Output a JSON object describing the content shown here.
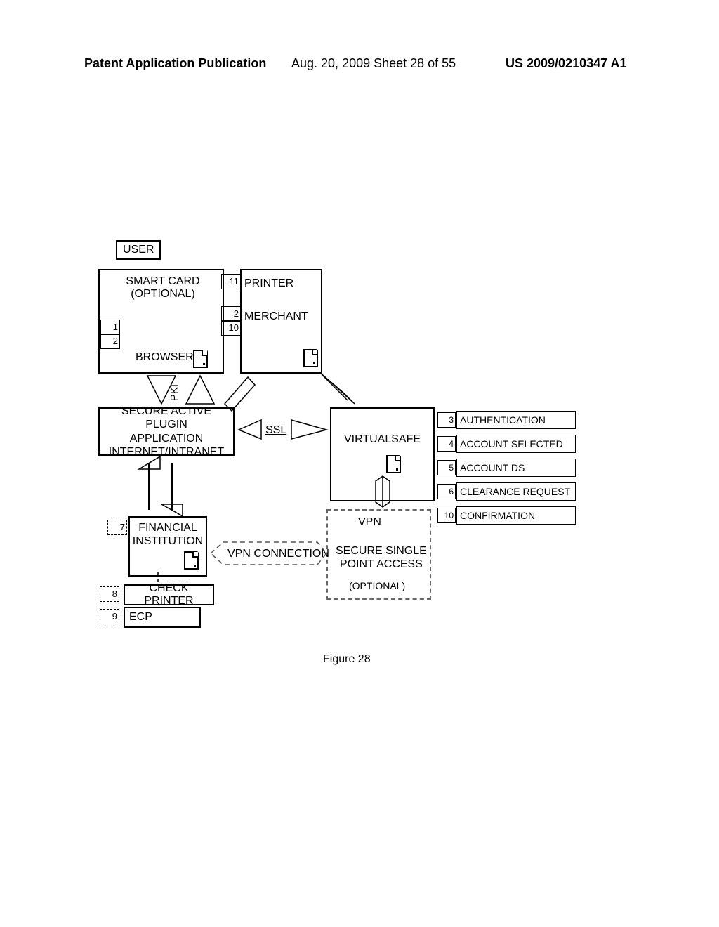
{
  "header": {
    "left": "Patent Application Publication",
    "center": "Aug. 20, 2009  Sheet 28 of 55",
    "right": "US 2009/0210347 A1"
  },
  "caption": "Figure 28",
  "labels": {
    "user": "USER",
    "smart_card_l1": "SMART CARD",
    "smart_card_l2": "(OPTIONAL)",
    "printer": "PRINTER",
    "merchant": "MERCHANT",
    "browser": "BROWSER",
    "pki": "PKI",
    "plugin_l1": "SECURE ACTIVE PLUGIN",
    "plugin_l2": "APPLICATION",
    "plugin_l3": "INTERNET/INTRANET",
    "ssl": "SSL",
    "virtualsafe": "VIRTUALSAFE",
    "vpn": "VPN",
    "vpn_connection": "VPN CONNECTION",
    "secure_l1": "SECURE SINGLE",
    "secure_l2": "POINT ACCESS",
    "optional": "(OPTIONAL)",
    "financial_l1": "FINANCIAL",
    "financial_l2": "INSTITUTION",
    "check_printer": "CHECK PRINTER",
    "ecp": "ECP"
  },
  "numbers": {
    "n1": "1",
    "n2": "2",
    "n2b": "2",
    "n10a": "10",
    "n11": "11",
    "n7": "7",
    "n8": "8",
    "n9": "9"
  },
  "right_list": [
    {
      "num": "3",
      "label": "AUTHENTICATION"
    },
    {
      "num": "4",
      "label": "ACCOUNT SELECTED"
    },
    {
      "num": "5",
      "label": "ACCOUNT DS"
    },
    {
      "num": "6",
      "label": "CLEARANCE REQUEST"
    },
    {
      "num": "10",
      "label": "CONFIRMATION"
    }
  ]
}
